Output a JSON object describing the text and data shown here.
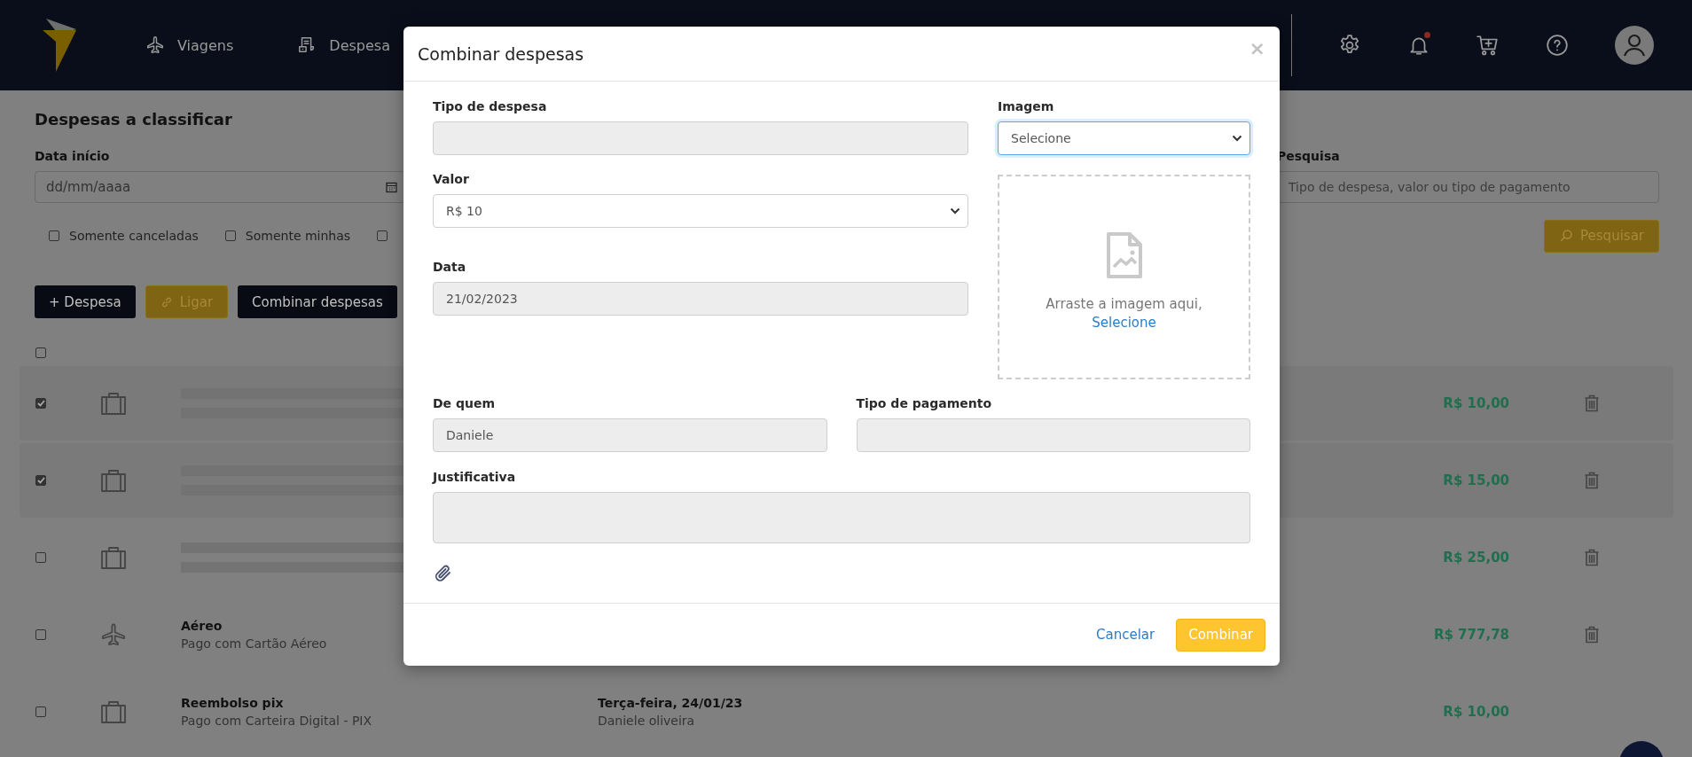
{
  "nav": {
    "items": [
      {
        "label": "Viagens"
      },
      {
        "label": "Despesa"
      }
    ],
    "notifications": {
      "unread": true
    }
  },
  "page": {
    "title": "Despesas a classificar",
    "start_date": {
      "label": "Data início",
      "placeholder": "dd/mm/aaaa"
    },
    "search": {
      "label": "Pesquisa",
      "placeholder": "Tipo de despesa, valor ou tipo de pagamento"
    },
    "filters": [
      {
        "label": "Somente canceladas",
        "checked": false
      },
      {
        "label": "Somente minhas",
        "checked": false
      },
      {
        "checked": false
      }
    ],
    "search_button": "Pesquisar",
    "actions": [
      {
        "label": "+ Despesa",
        "kind": "dark"
      },
      {
        "label": "Ligar",
        "kind": "link"
      },
      {
        "label": "Combinar despesas",
        "kind": "dark"
      }
    ],
    "select_all": {
      "checked": false
    },
    "rows": [
      {
        "kind": "luggage",
        "checked": true,
        "loading": true,
        "amount": "R$ 10,00",
        "deletable": true
      },
      {
        "kind": "luggage",
        "checked": true,
        "loading": true,
        "amount": "R$ 15,00",
        "deletable": true
      },
      {
        "kind": "luggage",
        "checked": false,
        "loading": true,
        "amount": "R$ 25,00",
        "deletable": true
      },
      {
        "kind": "flight",
        "checked": false,
        "loading": false,
        "title": "Aéreo",
        "subtitle": "Pago com Cartão Aéreo",
        "amount": "R$ 777,78",
        "deletable": true
      },
      {
        "kind": "luggage",
        "checked": false,
        "loading": false,
        "title": "Reembolso pix",
        "subtitle": "Pago com Carteira Digital - PIX",
        "date": "Terça-feira, 24/01/23",
        "person": "Daniele oliveira",
        "amount": "R$ 10,00",
        "deletable": false
      }
    ]
  },
  "modal": {
    "title": "Combinar despesas",
    "close": "×",
    "fields": [
      {
        "label": "Tipo de despesa",
        "kind": "input",
        "disabled": true
      },
      {
        "label": "Valor",
        "kind": "select",
        "value": "R$ 10",
        "disabled": false
      },
      {
        "label": "Data",
        "kind": "input",
        "value": "21/02/2023",
        "disabled": true
      }
    ],
    "image": {
      "label": "Imagem",
      "kind": "select",
      "value": "Selecione",
      "disabled": false,
      "focused": true,
      "drop_text": "Arraste a imagem aqui,",
      "drop_link": "Selecione"
    },
    "pair": [
      {
        "label": "De quem",
        "kind": "input",
        "value": "Daniele",
        "disabled": true
      },
      {
        "label": "Tipo de pagamento",
        "kind": "input",
        "disabled": true
      }
    ],
    "justification": {
      "label": "Justificativa",
      "kind": "textarea",
      "disabled": true
    },
    "cancel": "Cancelar",
    "confirm": "Combinar"
  }
}
